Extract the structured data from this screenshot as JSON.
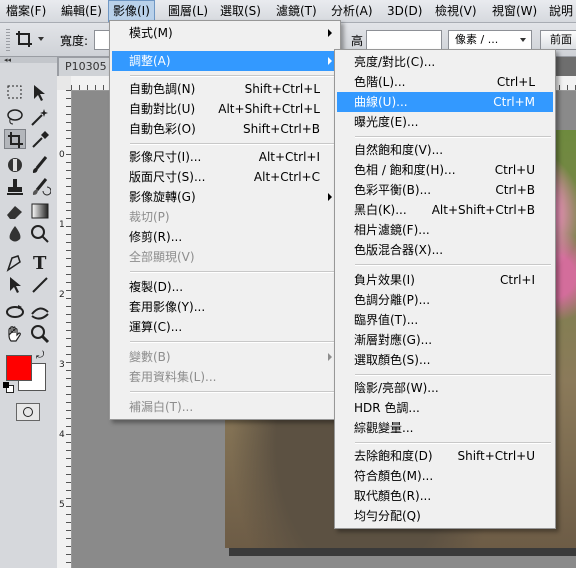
{
  "menubar": {
    "items": [
      {
        "label": "檔案(F)"
      },
      {
        "label": "編輯(E)"
      },
      {
        "label": "影像(I)"
      },
      {
        "label": "圖層(L)"
      },
      {
        "label": "選取(S)"
      },
      {
        "label": "濾鏡(T)"
      },
      {
        "label": "分析(A)"
      },
      {
        "label": "3D(D)"
      },
      {
        "label": "檢視(V)"
      },
      {
        "label": "視窗(W)"
      },
      {
        "label": "說明"
      }
    ]
  },
  "options": {
    "width_label": "寬度:",
    "height_label": "高度:",
    "unit_value": "像素 / ...",
    "front_image_button": "前面"
  },
  "document": {
    "tab_title": "P10305"
  },
  "rulers": {
    "left": [
      "0",
      "1",
      "2",
      "3",
      "4",
      "5"
    ]
  },
  "image_menu": {
    "items": [
      {
        "label": "模式(M)",
        "shortcut": "",
        "submenu": true
      },
      {
        "label": "調整(A)",
        "shortcut": "",
        "submenu": true
      },
      {
        "label": "自動色調(N)",
        "shortcut": "Shift+Ctrl+L"
      },
      {
        "label": "自動對比(U)",
        "shortcut": "Alt+Shift+Ctrl+L"
      },
      {
        "label": "自動色彩(O)",
        "shortcut": "Shift+Ctrl+B"
      },
      {
        "label": "影像尺寸(I)...",
        "shortcut": "Alt+Ctrl+I"
      },
      {
        "label": "版面尺寸(S)...",
        "shortcut": "Alt+Ctrl+C"
      },
      {
        "label": "影像旋轉(G)",
        "shortcut": "",
        "submenu": true
      },
      {
        "label": "裁切(P)",
        "shortcut": ""
      },
      {
        "label": "修剪(R)...",
        "shortcut": ""
      },
      {
        "label": "全部顯現(V)",
        "shortcut": ""
      },
      {
        "label": "複製(D)...",
        "shortcut": ""
      },
      {
        "label": "套用影像(Y)...",
        "shortcut": ""
      },
      {
        "label": "運算(C)...",
        "shortcut": ""
      },
      {
        "label": "變數(B)",
        "shortcut": "",
        "submenu": true
      },
      {
        "label": "套用資料集(L)...",
        "shortcut": ""
      },
      {
        "label": "補漏白(T)...",
        "shortcut": ""
      }
    ]
  },
  "adjust_menu": {
    "items": [
      {
        "label": "亮度/對比(C)...",
        "shortcut": ""
      },
      {
        "label": "色階(L)...",
        "shortcut": "Ctrl+L"
      },
      {
        "label": "曲線(U)...",
        "shortcut": "Ctrl+M"
      },
      {
        "label": "曝光度(E)...",
        "shortcut": ""
      },
      {
        "label": "自然飽和度(V)...",
        "shortcut": ""
      },
      {
        "label": "色相 / 飽和度(H)...",
        "shortcut": "Ctrl+U"
      },
      {
        "label": "色彩平衡(B)...",
        "shortcut": "Ctrl+B"
      },
      {
        "label": "黑白(K)...",
        "shortcut": "Alt+Shift+Ctrl+B"
      },
      {
        "label": "相片濾鏡(F)...",
        "shortcut": ""
      },
      {
        "label": "色版混合器(X)...",
        "shortcut": ""
      },
      {
        "label": "負片效果(I)",
        "shortcut": "Ctrl+I"
      },
      {
        "label": "色調分離(P)...",
        "shortcut": ""
      },
      {
        "label": "臨界值(T)...",
        "shortcut": ""
      },
      {
        "label": "漸層對應(G)...",
        "shortcut": ""
      },
      {
        "label": "選取顏色(S)...",
        "shortcut": ""
      },
      {
        "label": "陰影/亮部(W)...",
        "shortcut": ""
      },
      {
        "label": "HDR 色調...",
        "shortcut": ""
      },
      {
        "label": "綜觀變量...",
        "shortcut": ""
      },
      {
        "label": "去除飽和度(D)",
        "shortcut": "Shift+Ctrl+U"
      },
      {
        "label": "符合顏色(M)...",
        "shortcut": ""
      },
      {
        "label": "取代顏色(R)...",
        "shortcut": ""
      },
      {
        "label": "均勻分配(Q)",
        "shortcut": ""
      }
    ]
  },
  "colors": {
    "foreground": "#ff0000",
    "background": "#ffffff",
    "highlight": "#3399ff"
  }
}
